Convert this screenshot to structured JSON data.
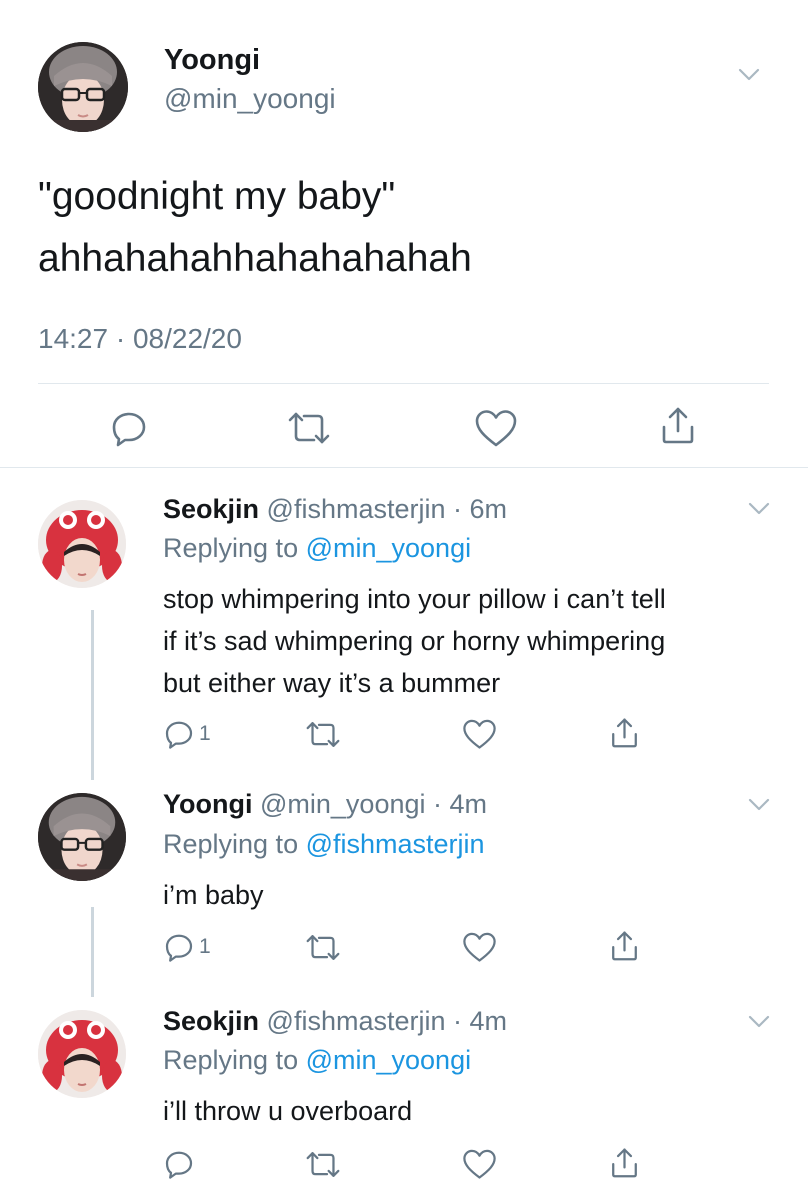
{
  "main_tweet": {
    "name": "Yoongi",
    "handle": "@min_yoongi",
    "text_line1": "\"goodnight my baby\"",
    "text_line2": "ahhahahahhahahahahah",
    "timestamp": "14:27 · 08/22/20",
    "actions": [
      "reply-icon",
      "retweet-icon",
      "like-icon",
      "share-icon"
    ]
  },
  "replies": [
    {
      "name": "Seokjin",
      "meta": "@fishmasterjin · 6m",
      "replying_prefix": "Replying to ",
      "replying_to": "@min_yoongi",
      "text_lines": [
        "stop whimpering into your pillow i can’t tell",
        "if it’s sad whimpering or horny whimpering",
        "but either way it’s a bummer"
      ],
      "reply_count": "1"
    },
    {
      "name": "Yoongi",
      "meta": "@min_yoongi · 4m",
      "replying_prefix": "Replying to ",
      "replying_to": "@fishmasterjin",
      "text_lines": [
        "i’m baby"
      ],
      "reply_count": "1"
    },
    {
      "name": "Seokjin",
      "meta": "@fishmasterjin · 4m",
      "replying_prefix": "Replying to ",
      "replying_to": "@min_yoongi",
      "text_lines": [
        "i’ll throw u overboard"
      ],
      "reply_count": ""
    }
  ],
  "colors": {
    "text": "#14171a",
    "secondary": "#657786",
    "link": "#1b95e0",
    "divider": "#e1e8ed",
    "thread_line": "#ccd6dd",
    "seokjin_hat": "#d8323f"
  }
}
